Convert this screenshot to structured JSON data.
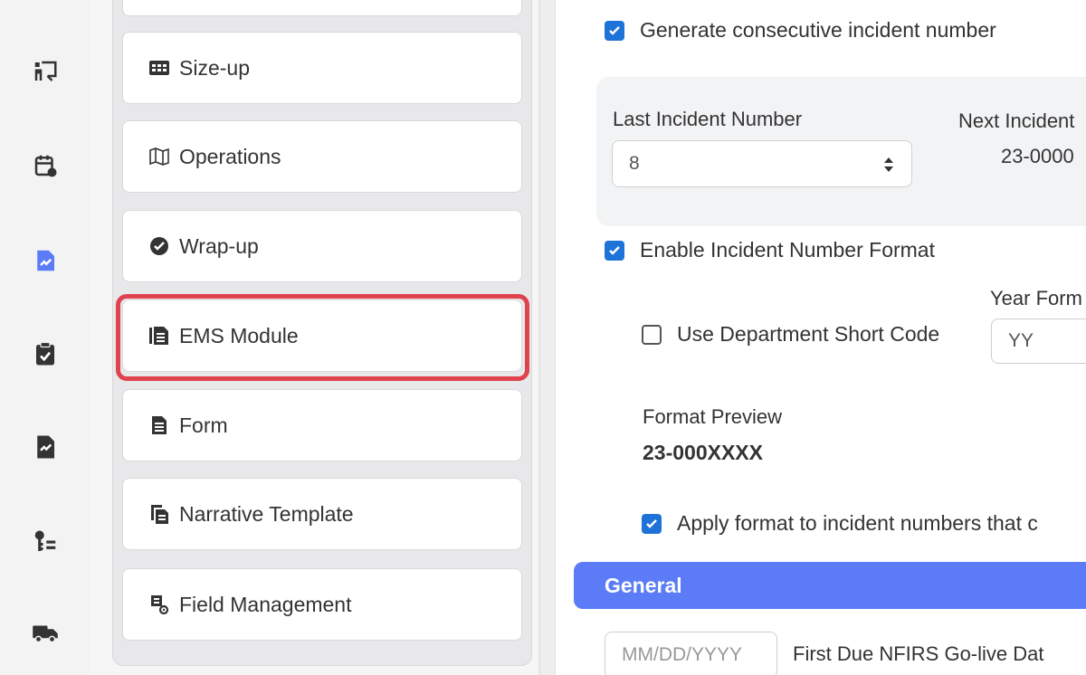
{
  "rail": {
    "icons": [
      {
        "name": "presentation-icon"
      },
      {
        "name": "calendar-icon"
      },
      {
        "name": "report-icon"
      },
      {
        "name": "clipboard-check-icon"
      },
      {
        "name": "file-check-icon"
      },
      {
        "name": "key-list-icon"
      },
      {
        "name": "truck-icon"
      }
    ],
    "active_color": "#5b7cf6"
  },
  "nav": {
    "items": [
      {
        "label": "",
        "icon": ""
      },
      {
        "label": "Size-up",
        "icon": "dashboard-icon"
      },
      {
        "label": "Operations",
        "icon": "map-icon"
      },
      {
        "label": "Wrap-up",
        "icon": "check-circle-icon"
      },
      {
        "label": "EMS Module",
        "icon": "documents-icon"
      },
      {
        "label": "Form",
        "icon": "file-text-icon"
      },
      {
        "label": "Narrative Template",
        "icon": "copy-doc-icon"
      },
      {
        "label": "Field Management",
        "icon": "field-settings-icon"
      }
    ],
    "highlight_color": "#e0424e"
  },
  "main": {
    "generate_consecutive": {
      "label": "Generate consecutive incident number",
      "checked": true
    },
    "last_incident": {
      "label": "Last Incident Number",
      "value": "8"
    },
    "next_incident": {
      "label": "Next Incident",
      "value": "23-0000"
    },
    "enable_format": {
      "label": "Enable Incident Number Format",
      "checked": true
    },
    "year_format": {
      "label": "Year Form",
      "value": "YY"
    },
    "dept_short_code": {
      "label": "Use Department Short Code",
      "checked": false
    },
    "format_preview": {
      "label": "Format Preview",
      "value": "23-000XXXX"
    },
    "apply_format": {
      "label": "Apply format to incident numbers that c",
      "checked": true
    },
    "section_general": {
      "label": "General",
      "color": "#5b7cf6"
    },
    "golive_date": {
      "placeholder": "MM/DD/YYYY",
      "label": "First Due NFIRS Go-live Dat"
    }
  },
  "colors": {
    "checkbox": "#1e73d8"
  }
}
